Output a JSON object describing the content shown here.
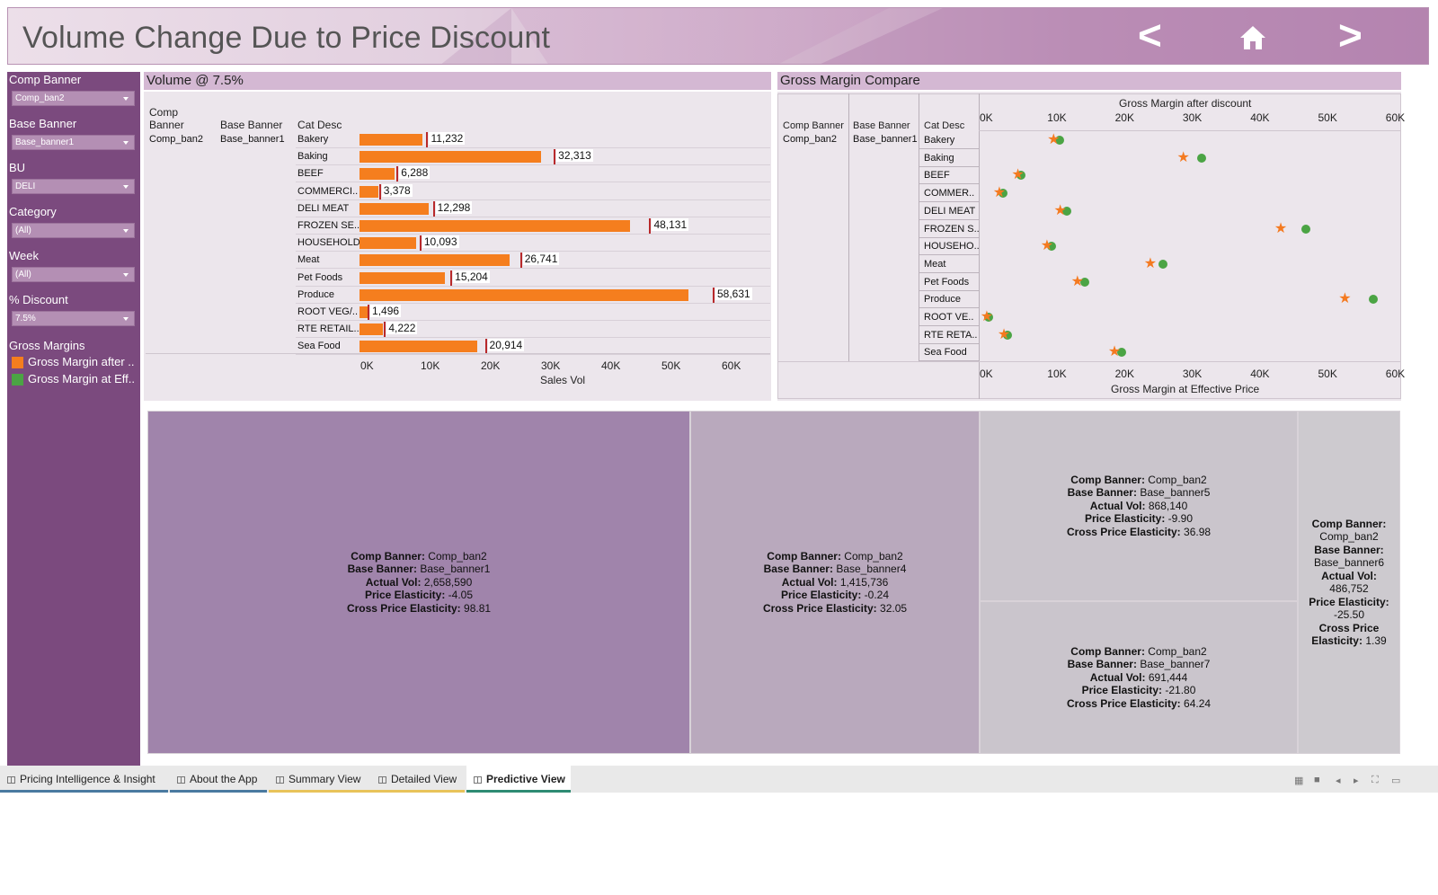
{
  "header": {
    "title": "Volume Change Due to Price Discount",
    "prev_label": "<",
    "home_icon": "home-icon",
    "next_label": ">"
  },
  "filters": [
    {
      "label": "Comp Banner",
      "value": "Comp_ban2"
    },
    {
      "label": "Base Banner",
      "value": "Base_banner1"
    },
    {
      "label": "BU",
      "value": "DELI"
    },
    {
      "label": "Category",
      "value": "(All)"
    },
    {
      "label": "Week",
      "value": "(All)"
    },
    {
      "label": "% Discount",
      "value": "7.5%"
    }
  ],
  "legend": {
    "title": "Gross Margins",
    "items": [
      {
        "label": "Gross Margin after ..",
        "color": "#f57e1e"
      },
      {
        "label": "Gross Margin at Eff..",
        "color": "#4ba444"
      }
    ]
  },
  "volume_panel": {
    "title": "Volume @ 7.5%",
    "col_comp": "Comp Banner",
    "col_base": "Base Banner",
    "col_cat": "Cat Desc",
    "comp_value": "Comp_ban2",
    "base_value": "Base_banner1",
    "x_axis_title": "Sales Vol"
  },
  "gm_panel": {
    "title": "Gross Margin Compare",
    "col_comp": "Comp Banner",
    "col_base": "Base Banner",
    "col_cat": "Cat Desc",
    "comp_value": "Comp_ban2",
    "base_value": "Base_banner1",
    "top_axis_title": "Gross Margin after discount",
    "bottom_axis_title": "Gross Margin at Effective Price"
  },
  "chart_data": [
    {
      "type": "bar",
      "title": "Volume @ 7.5%",
      "xlabel": "Sales Vol",
      "categories": [
        "Bakery",
        "Baking",
        "BEEF",
        "COMMERCI..",
        "DELI MEAT",
        "FROZEN SE..",
        "HOUSEHOLD",
        "Meat",
        "Pet Foods",
        "Produce",
        "ROOT VEG/..",
        "RTE RETAIL..",
        "Sea Food"
      ],
      "values": [
        11232,
        32313,
        6288,
        3378,
        12298,
        48131,
        10093,
        26741,
        15204,
        58631,
        1496,
        4222,
        20914
      ],
      "value_labels": [
        "11,232",
        "32,313",
        "6,288",
        "3,378",
        "12,298",
        "48,131",
        "10,093",
        "26,741",
        "15,204",
        "58,631",
        "1,496",
        "4,222",
        "20,914"
      ],
      "bar_fraction": 0.93,
      "ticks": [
        "0K",
        "10K",
        "20K",
        "30K",
        "40K",
        "50K",
        "60K"
      ],
      "xlim": [
        0,
        65000
      ]
    },
    {
      "type": "scatter",
      "title": "Gross Margin Compare",
      "categories": [
        "Bakery",
        "Baking",
        "BEEF",
        "COMMER..",
        "DELI MEAT",
        "FROZEN S..",
        "HOUSEHO..",
        "Meat",
        "Pet Foods",
        "Produce",
        "ROOT VE..",
        "RTE RETA..",
        "Sea Food"
      ],
      "series": [
        {
          "name": "Gross Margin after ..",
          "marker": "star",
          "color": "#f47a20",
          "values": [
            10200,
            29800,
            4800,
            2000,
            11200,
            44500,
            9200,
            24800,
            13800,
            54200,
            100,
            2700,
            19400
          ]
        },
        {
          "name": "Gross Margin at Eff..",
          "marker": "circle",
          "color": "#4ba444",
          "values": [
            11000,
            32400,
            5200,
            2400,
            12100,
            48200,
            9800,
            26600,
            14800,
            58400,
            300,
            3100,
            20400
          ]
        }
      ],
      "ticks": [
        "0K",
        "10K",
        "20K",
        "30K",
        "40K",
        "50K",
        "60K"
      ],
      "xlim": [
        0,
        60000
      ],
      "xlabel_top": "Gross Margin after discount",
      "xlabel_bottom": "Gross Margin at Effective Price"
    }
  ],
  "treemap": [
    {
      "comp": "Comp_ban2",
      "base": "Base_banner1",
      "vol": "2,658,590",
      "pe": "-4.05",
      "cpe": "98.81",
      "color": "#a084ab"
    },
    {
      "comp": "Comp_ban2",
      "base": "Base_banner4",
      "vol": "1,415,736",
      "pe": "-0.24",
      "cpe": "32.05",
      "color": "#b9a9bd"
    },
    {
      "comp": "Comp_ban2",
      "base": "Base_banner5",
      "vol": "868,140",
      "pe": "-9.90",
      "cpe": "36.98",
      "color": "#cac5cc"
    },
    {
      "comp": "Comp_ban2",
      "base": "Base_banner7",
      "vol": "691,444",
      "pe": "-21.80",
      "cpe": "64.24",
      "color": "#cac5cc"
    },
    {
      "comp": "Comp_ban2",
      "base": "Base_banner6",
      "vol": "486,752",
      "pe": "-25.50",
      "cpe": "1.39",
      "color": "#cdcacf"
    }
  ],
  "treemap_labels": {
    "comp": "Comp Banner:",
    "base": "Base Banner:",
    "vol": "Actual Vol:",
    "pe": "Price Elasticity:",
    "cpe": "Cross Price Elasticity:",
    "cpe_a": "Cross Price",
    "cpe_b": "Elasticity:"
  },
  "tabs": [
    {
      "label": "Pricing Intelligence & Insight",
      "color": "#4a7aa0"
    },
    {
      "label": "About the App",
      "color": "#4a7aa0"
    },
    {
      "label": "Summary View",
      "color": "#e8c35a"
    },
    {
      "label": "Detailed View",
      "color": "#e8c35a"
    },
    {
      "label": "Predictive View",
      "color": "#2e8b73",
      "active": true
    }
  ]
}
